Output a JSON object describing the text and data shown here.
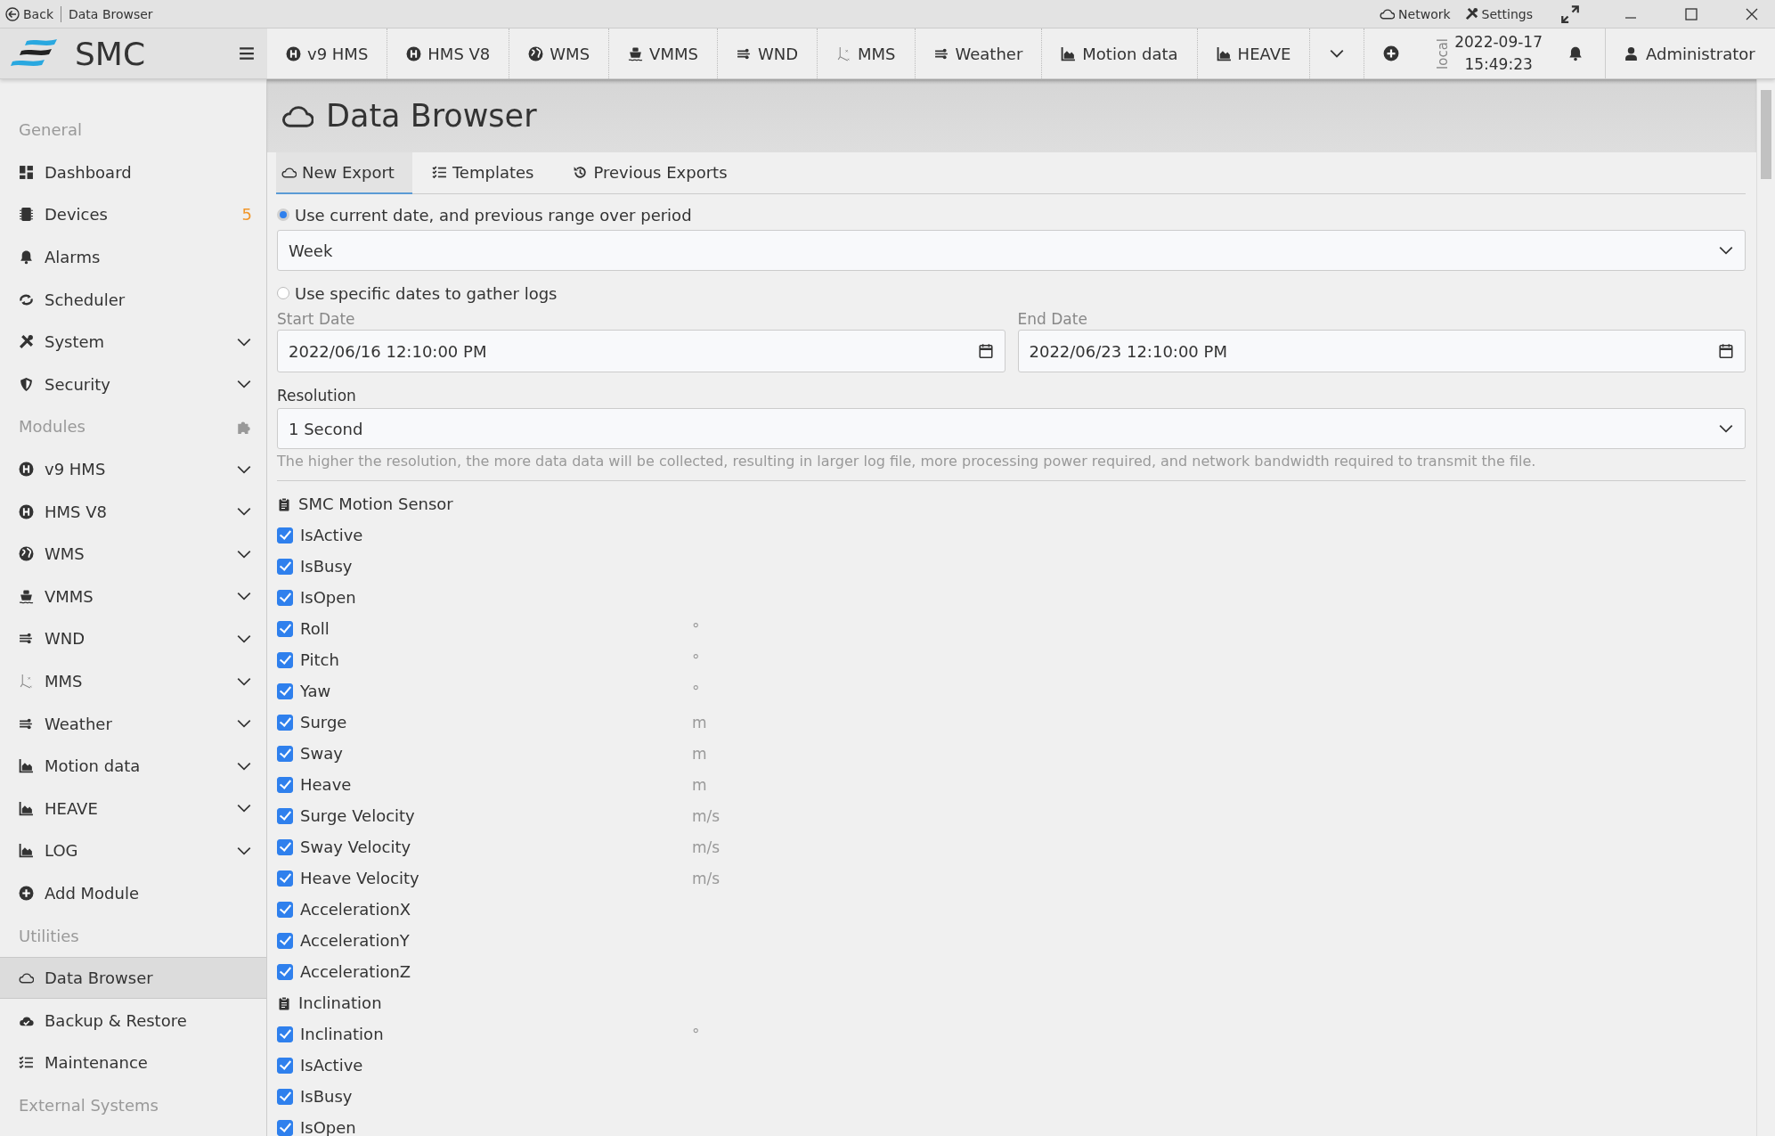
{
  "titlebar": {
    "back": "Back",
    "page": "Data Browser",
    "network": "Network",
    "settings": "Settings"
  },
  "header": {
    "logo": "SMC",
    "modules": [
      {
        "label": "v9 HMS"
      },
      {
        "label": "HMS V8"
      },
      {
        "label": "WMS"
      },
      {
        "label": "VMMS"
      },
      {
        "label": "WND"
      },
      {
        "label": "MMS"
      },
      {
        "label": "Weather"
      },
      {
        "label": "Motion data"
      },
      {
        "label": "HEAVE"
      }
    ],
    "clock": {
      "zone": "local",
      "date": "2022-09-17",
      "time": "15:49:23"
    },
    "user": "Administrator"
  },
  "sidebar": {
    "sections": [
      {
        "title": "General",
        "items": [
          {
            "label": "Dashboard",
            "kind": "link",
            "selected": false
          },
          {
            "label": "Devices",
            "kind": "link",
            "badge": "5",
            "selected": false
          },
          {
            "label": "Alarms",
            "kind": "link",
            "selected": false
          },
          {
            "label": "Scheduler",
            "kind": "link",
            "selected": false
          },
          {
            "label": "System",
            "kind": "group",
            "selected": false
          },
          {
            "label": "Security",
            "kind": "group",
            "selected": false
          }
        ]
      },
      {
        "title": "Modules",
        "items": [
          {
            "label": "v9 HMS",
            "kind": "group",
            "selected": false
          },
          {
            "label": "HMS V8",
            "kind": "group",
            "selected": false
          },
          {
            "label": "WMS",
            "kind": "group",
            "selected": false
          },
          {
            "label": "VMMS",
            "kind": "group",
            "selected": false
          },
          {
            "label": "WND",
            "kind": "group",
            "selected": false
          },
          {
            "label": "MMS",
            "kind": "group",
            "selected": false
          },
          {
            "label": "Weather",
            "kind": "group",
            "selected": false
          },
          {
            "label": "Motion data",
            "kind": "group",
            "selected": false
          },
          {
            "label": "HEAVE",
            "kind": "group",
            "selected": false
          },
          {
            "label": "LOG",
            "kind": "group",
            "selected": false
          },
          {
            "label": "Add Module",
            "kind": "link",
            "selected": false
          }
        ]
      },
      {
        "title": "Utilities",
        "items": [
          {
            "label": "Data Browser",
            "kind": "link",
            "selected": true
          },
          {
            "label": "Backup & Restore",
            "kind": "link",
            "selected": false
          },
          {
            "label": "Maintenance",
            "kind": "link",
            "selected": false
          }
        ]
      },
      {
        "title": "External Systems"
      }
    ]
  },
  "page": {
    "title": "Data Browser",
    "tabs": [
      {
        "label": "New Export",
        "selected": true
      },
      {
        "label": "Templates",
        "selected": false
      },
      {
        "label": "Previous Exports",
        "selected": false
      }
    ],
    "period_option": {
      "label": "Use current date, and previous range over period",
      "selected": true,
      "value": "Week"
    },
    "dates_option": {
      "label": "Use specific dates to gather logs",
      "selected": false,
      "start_label": "Start Date",
      "start_value": "2022/06/16 12:10:00 PM",
      "end_label": "End Date",
      "end_value": "2022/06/23 12:10:00 PM"
    },
    "resolution": {
      "label": "Resolution",
      "value": "1 Second",
      "help": "The higher the resolution, the more data data will be collected, resulting in larger log file, more processing power required, and network bandwidth required to transmit the file."
    },
    "groups": [
      {
        "title": "SMC Motion Sensor",
        "fields": [
          {
            "label": "IsActive",
            "checked": true
          },
          {
            "label": "IsBusy",
            "checked": true
          },
          {
            "label": "IsOpen",
            "checked": true
          },
          {
            "label": "Roll",
            "unit": "°",
            "checked": true
          },
          {
            "label": "Pitch",
            "unit": "°",
            "checked": true
          },
          {
            "label": "Yaw",
            "unit": "°",
            "checked": true
          },
          {
            "label": "Surge",
            "unit": "m",
            "checked": true
          },
          {
            "label": "Sway",
            "unit": "m",
            "checked": true
          },
          {
            "label": "Heave",
            "unit": "m",
            "checked": true
          },
          {
            "label": "Surge Velocity",
            "unit": "m/s",
            "checked": true
          },
          {
            "label": "Sway Velocity",
            "unit": "m/s",
            "checked": true
          },
          {
            "label": "Heave Velocity",
            "unit": "m/s",
            "checked": true
          },
          {
            "label": "AccelerationX",
            "checked": true
          },
          {
            "label": "AccelerationY",
            "checked": true
          },
          {
            "label": "AccelerationZ",
            "checked": true
          }
        ]
      },
      {
        "title": "Inclination",
        "fields": [
          {
            "label": "Inclination",
            "unit": "°",
            "checked": true
          },
          {
            "label": "IsActive",
            "checked": true
          },
          {
            "label": "IsBusy",
            "checked": true
          },
          {
            "label": "IsOpen",
            "checked": true
          }
        ]
      }
    ]
  }
}
